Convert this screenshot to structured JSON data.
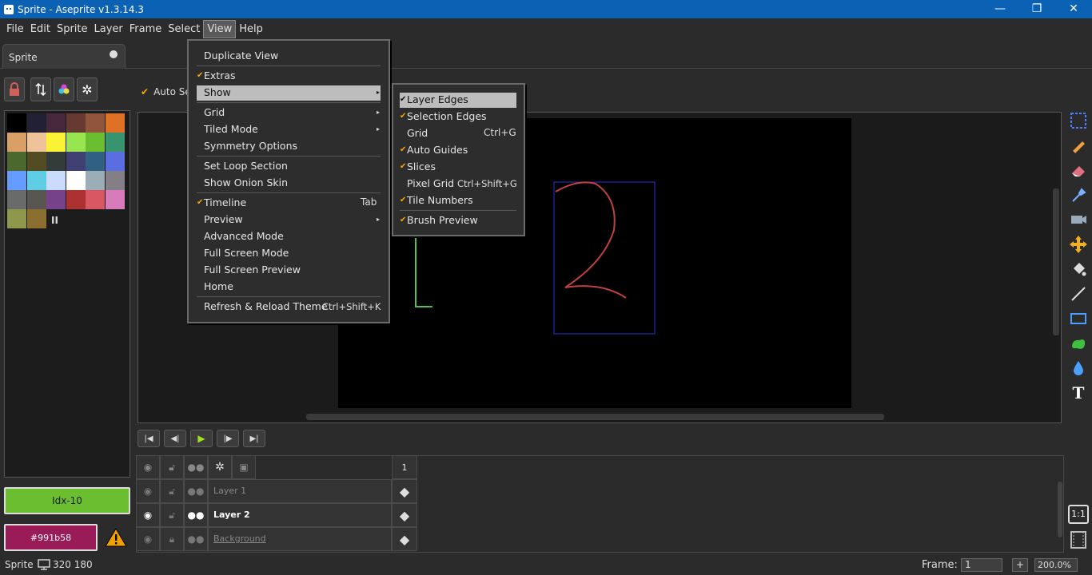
{
  "window": {
    "title": "Sprite - Aseprite v1.3.14.3",
    "min": "—",
    "max": "❐",
    "close": "✕"
  },
  "menubar": [
    "File",
    "Edit",
    "Sprite",
    "Layer",
    "Frame",
    "Select",
    "View",
    "Help"
  ],
  "tab": {
    "label": "Sprite"
  },
  "context": {
    "auto_select": "Auto Sel"
  },
  "palette": {
    "colors": [
      "#000000",
      "#222034",
      "#45283c",
      "#663931",
      "#8f563b",
      "#df7126",
      "#d9a066",
      "#eec39a",
      "#fbf236",
      "#99e550",
      "#6abe30",
      "#37946e",
      "#4b692f",
      "#524b24",
      "#323c39",
      "#3f3f74",
      "#306082",
      "#5b6ee1",
      "#639bff",
      "#5fcde4",
      "#cbdbfc",
      "#ffffff",
      "#9badb7",
      "#847e87",
      "#696a6a",
      "#595652",
      "#76428a",
      "#ac3232",
      "#d95763",
      "#d77bba",
      "#8f974a",
      "#8a6f30"
    ],
    "pause": "II"
  },
  "fg_color": {
    "label": "Idx-10",
    "hex": "#6bbe30"
  },
  "bg_color": {
    "label": "#991b58",
    "hex": "#991b58"
  },
  "view_menu": {
    "items": [
      {
        "label": "Duplicate View"
      },
      {
        "label": "Extras",
        "checked": true
      },
      {
        "label": "Show",
        "submenu": true,
        "highlighted": true
      },
      {
        "label": "Grid",
        "submenu": true
      },
      {
        "label": "Tiled Mode",
        "submenu": true
      },
      {
        "label": "Symmetry Options"
      },
      {
        "label": "Set Loop Section"
      },
      {
        "label": "Show Onion Skin"
      },
      {
        "label": "Timeline",
        "checked": true,
        "shortcut": "Tab"
      },
      {
        "label": "Preview",
        "submenu": true
      },
      {
        "label": "Advanced Mode"
      },
      {
        "label": "Full Screen Mode"
      },
      {
        "label": "Full Screen Preview"
      },
      {
        "label": "Home"
      },
      {
        "label": "Refresh & Reload Theme",
        "shortcut": "Ctrl+Shift+K"
      }
    ]
  },
  "show_menu": {
    "items": [
      {
        "label": "Layer Edges",
        "checked": true
      },
      {
        "label": "Selection Edges",
        "checked": true
      },
      {
        "label": "Grid",
        "shortcut": "Ctrl+G"
      },
      {
        "label": "Auto Guides",
        "checked": true
      },
      {
        "label": "Slices",
        "checked": true
      },
      {
        "label": "Pixel Grid",
        "shortcut": "Ctrl+Shift+G"
      },
      {
        "label": "Tile Numbers",
        "checked": true
      },
      {
        "label": "Brush Preview",
        "checked": true
      }
    ]
  },
  "timeline": {
    "frame_header": "1",
    "layers": [
      {
        "name": "Layer 1",
        "active": false
      },
      {
        "name": "Layer 2",
        "active": true
      },
      {
        "name": "Background",
        "active": false
      }
    ]
  },
  "status": {
    "sprite": "Sprite",
    "size": "320 180",
    "frame_label": "Frame:",
    "frame_value": "1",
    "plus": "+",
    "zoom": "200.0%",
    "ratio": "1:1"
  }
}
